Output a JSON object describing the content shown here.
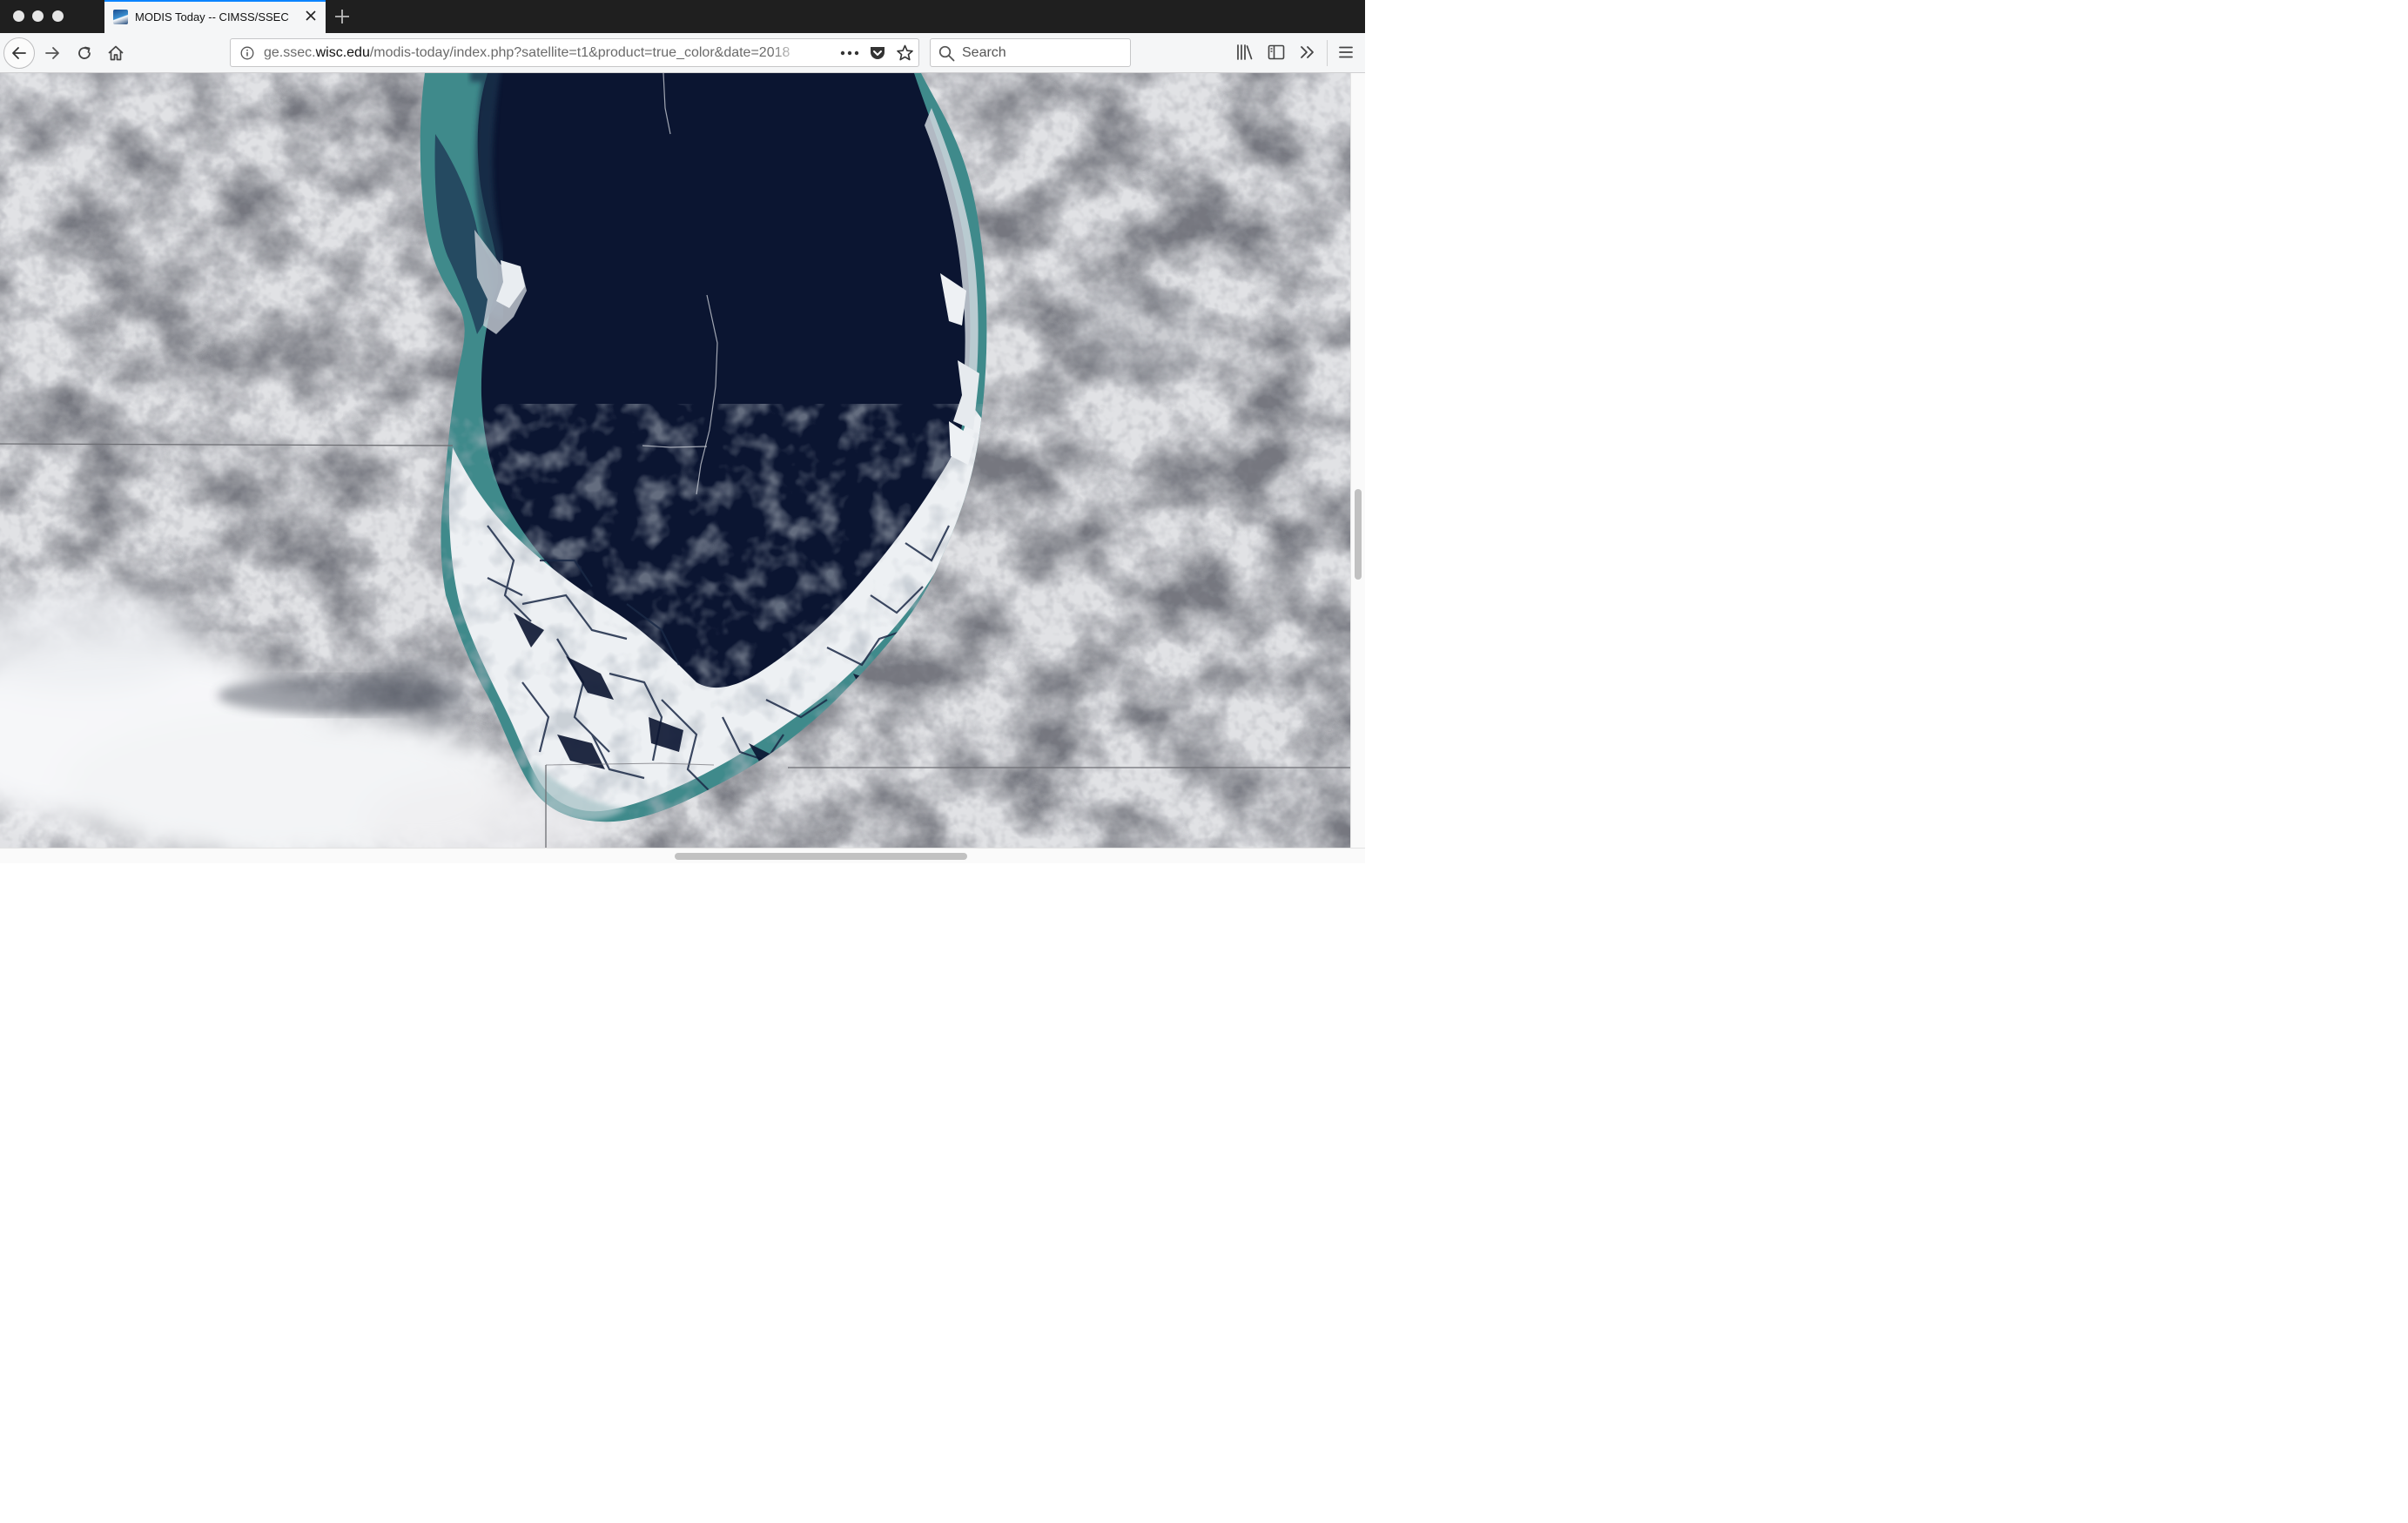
{
  "browser": {
    "window_controls": [
      "close",
      "minimize",
      "maximize"
    ],
    "tab": {
      "title": "MODIS Today -- CIMSS/SSEC",
      "favicon": "modis-favicon-icon"
    },
    "url": {
      "prefix": "ge.ssec.",
      "host": "wisc.edu",
      "path": "/modis-today/index.php?satellite=t1&product=true_color&date=2018"
    },
    "search_placeholder": "Search",
    "toolbar_icons": [
      "library-icon",
      "sidebar-icon",
      "overflow-chevron-icon",
      "hamburger-menu-icon"
    ]
  },
  "image": {
    "description_tag": "satellite-true-color-image",
    "colors": {
      "lake_deep": "#0b1632",
      "lake_shallow_sediment": "#3f8f8c",
      "ice": "#eef1f4",
      "snow_land": "#dedfe1",
      "border_lines": "#6a6a6a"
    }
  }
}
